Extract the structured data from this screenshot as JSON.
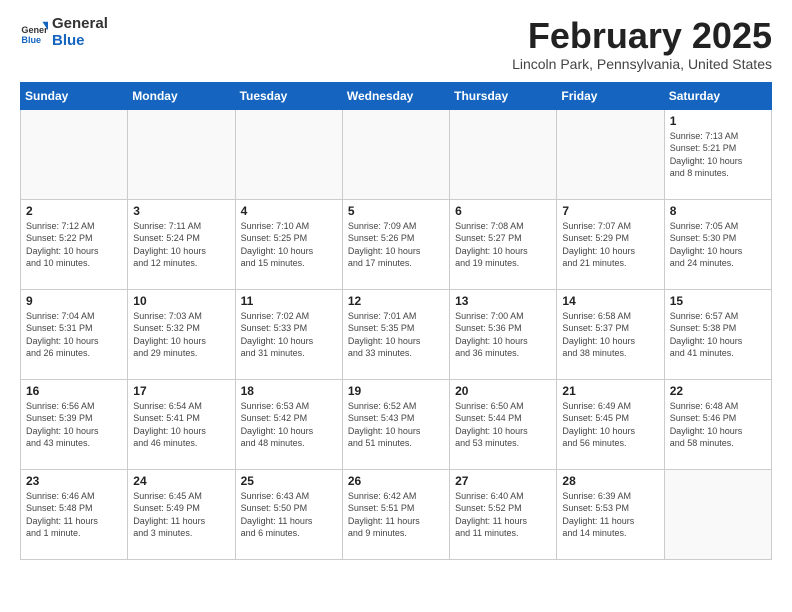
{
  "logo": {
    "general": "General",
    "blue": "Blue"
  },
  "header": {
    "month": "February 2025",
    "location": "Lincoln Park, Pennsylvania, United States"
  },
  "weekdays": [
    "Sunday",
    "Monday",
    "Tuesday",
    "Wednesday",
    "Thursday",
    "Friday",
    "Saturday"
  ],
  "weeks": [
    [
      {
        "day": "",
        "info": ""
      },
      {
        "day": "",
        "info": ""
      },
      {
        "day": "",
        "info": ""
      },
      {
        "day": "",
        "info": ""
      },
      {
        "day": "",
        "info": ""
      },
      {
        "day": "",
        "info": ""
      },
      {
        "day": "1",
        "info": "Sunrise: 7:13 AM\nSunset: 5:21 PM\nDaylight: 10 hours\nand 8 minutes."
      }
    ],
    [
      {
        "day": "2",
        "info": "Sunrise: 7:12 AM\nSunset: 5:22 PM\nDaylight: 10 hours\nand 10 minutes."
      },
      {
        "day": "3",
        "info": "Sunrise: 7:11 AM\nSunset: 5:24 PM\nDaylight: 10 hours\nand 12 minutes."
      },
      {
        "day": "4",
        "info": "Sunrise: 7:10 AM\nSunset: 5:25 PM\nDaylight: 10 hours\nand 15 minutes."
      },
      {
        "day": "5",
        "info": "Sunrise: 7:09 AM\nSunset: 5:26 PM\nDaylight: 10 hours\nand 17 minutes."
      },
      {
        "day": "6",
        "info": "Sunrise: 7:08 AM\nSunset: 5:27 PM\nDaylight: 10 hours\nand 19 minutes."
      },
      {
        "day": "7",
        "info": "Sunrise: 7:07 AM\nSunset: 5:29 PM\nDaylight: 10 hours\nand 21 minutes."
      },
      {
        "day": "8",
        "info": "Sunrise: 7:05 AM\nSunset: 5:30 PM\nDaylight: 10 hours\nand 24 minutes."
      }
    ],
    [
      {
        "day": "9",
        "info": "Sunrise: 7:04 AM\nSunset: 5:31 PM\nDaylight: 10 hours\nand 26 minutes."
      },
      {
        "day": "10",
        "info": "Sunrise: 7:03 AM\nSunset: 5:32 PM\nDaylight: 10 hours\nand 29 minutes."
      },
      {
        "day": "11",
        "info": "Sunrise: 7:02 AM\nSunset: 5:33 PM\nDaylight: 10 hours\nand 31 minutes."
      },
      {
        "day": "12",
        "info": "Sunrise: 7:01 AM\nSunset: 5:35 PM\nDaylight: 10 hours\nand 33 minutes."
      },
      {
        "day": "13",
        "info": "Sunrise: 7:00 AM\nSunset: 5:36 PM\nDaylight: 10 hours\nand 36 minutes."
      },
      {
        "day": "14",
        "info": "Sunrise: 6:58 AM\nSunset: 5:37 PM\nDaylight: 10 hours\nand 38 minutes."
      },
      {
        "day": "15",
        "info": "Sunrise: 6:57 AM\nSunset: 5:38 PM\nDaylight: 10 hours\nand 41 minutes."
      }
    ],
    [
      {
        "day": "16",
        "info": "Sunrise: 6:56 AM\nSunset: 5:39 PM\nDaylight: 10 hours\nand 43 minutes."
      },
      {
        "day": "17",
        "info": "Sunrise: 6:54 AM\nSunset: 5:41 PM\nDaylight: 10 hours\nand 46 minutes."
      },
      {
        "day": "18",
        "info": "Sunrise: 6:53 AM\nSunset: 5:42 PM\nDaylight: 10 hours\nand 48 minutes."
      },
      {
        "day": "19",
        "info": "Sunrise: 6:52 AM\nSunset: 5:43 PM\nDaylight: 10 hours\nand 51 minutes."
      },
      {
        "day": "20",
        "info": "Sunrise: 6:50 AM\nSunset: 5:44 PM\nDaylight: 10 hours\nand 53 minutes."
      },
      {
        "day": "21",
        "info": "Sunrise: 6:49 AM\nSunset: 5:45 PM\nDaylight: 10 hours\nand 56 minutes."
      },
      {
        "day": "22",
        "info": "Sunrise: 6:48 AM\nSunset: 5:46 PM\nDaylight: 10 hours\nand 58 minutes."
      }
    ],
    [
      {
        "day": "23",
        "info": "Sunrise: 6:46 AM\nSunset: 5:48 PM\nDaylight: 11 hours\nand 1 minute."
      },
      {
        "day": "24",
        "info": "Sunrise: 6:45 AM\nSunset: 5:49 PM\nDaylight: 11 hours\nand 3 minutes."
      },
      {
        "day": "25",
        "info": "Sunrise: 6:43 AM\nSunset: 5:50 PM\nDaylight: 11 hours\nand 6 minutes."
      },
      {
        "day": "26",
        "info": "Sunrise: 6:42 AM\nSunset: 5:51 PM\nDaylight: 11 hours\nand 9 minutes."
      },
      {
        "day": "27",
        "info": "Sunrise: 6:40 AM\nSunset: 5:52 PM\nDaylight: 11 hours\nand 11 minutes."
      },
      {
        "day": "28",
        "info": "Sunrise: 6:39 AM\nSunset: 5:53 PM\nDaylight: 11 hours\nand 14 minutes."
      },
      {
        "day": "",
        "info": ""
      }
    ]
  ]
}
